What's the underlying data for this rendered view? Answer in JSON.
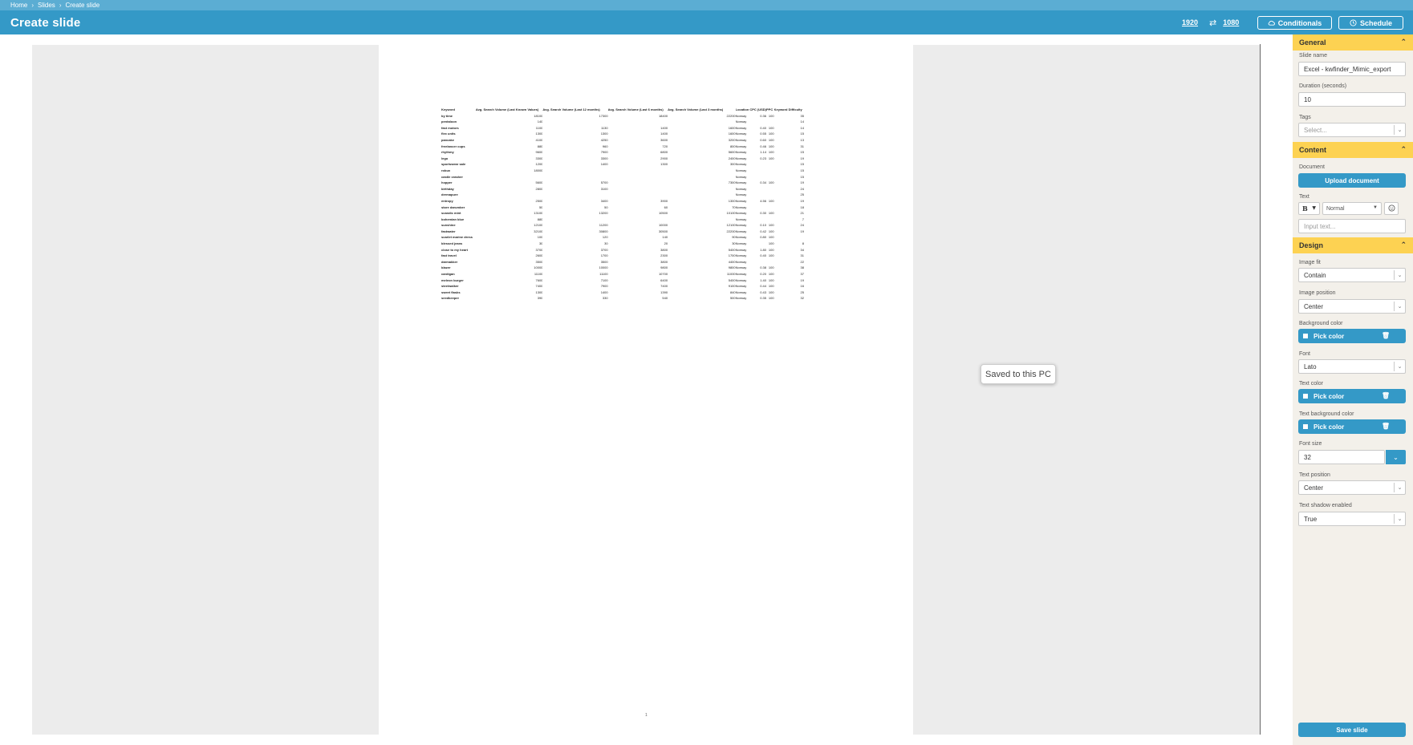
{
  "breadcrumb": [
    "Home",
    "Slides",
    "Create slide"
  ],
  "header": {
    "title": "Create slide",
    "width": "1920",
    "height": "1080",
    "conditionals_label": "Conditionals",
    "schedule_label": "Schedule"
  },
  "preview": {
    "page_number": "1",
    "toast": "Saved to this PC"
  },
  "table": {
    "headers": [
      "Keyword",
      "Avg. Search Volume (Last Known Values)",
      "Avg. Search Volume (Last 12 months)",
      "Avg. Search Volume (Last 6 months)",
      "Avg. Search Volume (Last 3 months)",
      "Location",
      "CPC (USD)",
      "PPC",
      "Keyword Difficulty"
    ],
    "rows": [
      [
        "by time",
        "18100",
        "17300",
        "18400",
        "22200",
        "Norway",
        "0.36",
        "100",
        "35"
      ],
      [
        "pentaloon",
        "140",
        "",
        "",
        "",
        "Norway",
        "",
        "",
        "14"
      ],
      [
        "fast motors",
        "1100",
        "1130",
        "1400",
        "1600",
        "Norway",
        "0.40",
        "100",
        "14"
      ],
      [
        "flex units",
        "1300",
        "1300",
        "1400",
        "1600",
        "Norway",
        "0.55",
        "100",
        "15"
      ],
      [
        "pancake",
        "4100",
        "4250",
        "3600",
        "3200",
        "Norway",
        "0.60",
        "100",
        "13"
      ],
      [
        "freelancer cups",
        "880",
        "960",
        "720",
        "800",
        "Norway",
        "0.46",
        "100",
        "31"
      ],
      [
        "rhythmy",
        "9600",
        "7900",
        "6800",
        "5600",
        "Norway",
        "1.14",
        "100",
        "15"
      ],
      [
        "lego",
        "3300",
        "3300",
        "2900",
        "2400",
        "Norway",
        "0.23",
        "100",
        "19"
      ],
      [
        "sportswear sale",
        "1200",
        "1400",
        "1300",
        "300",
        "Norway",
        "",
        "",
        "15"
      ],
      [
        "robux",
        "18000",
        "",
        "",
        "",
        "Norway",
        "",
        "",
        "15"
      ],
      [
        "castle crasher",
        "",
        "",
        "",
        "",
        "Norway",
        "",
        "",
        "15"
      ],
      [
        "hopper",
        "5600",
        "5700",
        "",
        "7300",
        "Norway",
        "0.34",
        "100",
        "19"
      ],
      [
        "birthday",
        "2800",
        "3100",
        "",
        "",
        "Norway",
        "",
        "",
        "24"
      ],
      [
        "dermapure",
        "",
        "",
        "",
        "",
        "Norway",
        "",
        "",
        "25"
      ],
      [
        "entropy",
        "2500",
        "3400",
        "3900",
        "1300",
        "Norway",
        "4.56",
        "100",
        "19"
      ],
      [
        "store darumber",
        "50",
        "50",
        "60",
        "70",
        "Norway",
        "",
        "",
        "18"
      ],
      [
        "scandic mint",
        "13100",
        "13200",
        "10500",
        "10100",
        "Norway",
        "0.30",
        "100",
        "21"
      ],
      [
        "bohemian blue",
        "880",
        "",
        "",
        "",
        "Norway",
        "",
        "",
        "7"
      ],
      [
        "sunshine",
        "12100",
        "11200",
        "10000",
        "12100",
        "Norway",
        "0.10",
        "100",
        "24"
      ],
      [
        "fastwater",
        "32100",
        "30800",
        "30500",
        "22200",
        "Norway",
        "0.42",
        "100",
        "19"
      ],
      [
        "scarlet marine dress",
        "100",
        "120",
        "140",
        "90",
        "Norway",
        "0.80",
        "100",
        ""
      ],
      [
        "blessed jeans",
        "30",
        "30",
        "20",
        "30",
        "Norway",
        "",
        "100",
        "8"
      ],
      [
        "close to my heart",
        "3700",
        "3700",
        "3800",
        "5400",
        "Norway",
        "1.80",
        "100",
        "34"
      ],
      [
        "fast travel",
        "2600",
        "1700",
        "2300",
        "1700",
        "Norway",
        "0.40",
        "100",
        "31"
      ],
      [
        "darmakker",
        "3500",
        "3500",
        "3800",
        "4400",
        "Norway",
        "",
        "",
        "22"
      ],
      [
        "blazer",
        "10000",
        "10000",
        "9800",
        "9800",
        "Norway",
        "0.38",
        "100",
        "38"
      ],
      [
        "cardigan",
        "11100",
        "11100",
        "10700",
        "11000",
        "Norway",
        "0.20",
        "100",
        "37"
      ],
      [
        "meleon burger",
        "7600",
        "7100",
        "6400",
        "5400",
        "Norway",
        "1.40",
        "100",
        "19"
      ],
      [
        "steelwalker",
        "7400",
        "7900",
        "7400",
        "9100",
        "Norway",
        "0.44",
        "100",
        "16"
      ],
      [
        "sweet flasks",
        "1300",
        "1400",
        "1390",
        "840",
        "Norway",
        "0.43",
        "100",
        "25"
      ],
      [
        "seedkeeper",
        "390",
        "330",
        "540",
        "500",
        "Norway",
        "0.35",
        "100",
        "32"
      ]
    ]
  },
  "sidebar": {
    "general": {
      "title": "General",
      "slide_name_label": "Slide name",
      "slide_name_value": "Excel - kwfinder_Mimic_export",
      "duration_label": "Duration (seconds)",
      "duration_value": "10",
      "tags_label": "Tags",
      "tags_placeholder": "Select..."
    },
    "content": {
      "title": "Content",
      "document_label": "Document",
      "upload_label": "Upload document",
      "text_label": "Text",
      "bold_label": "B",
      "style_value": "Normal",
      "text_placeholder": "Input text..."
    },
    "design": {
      "title": "Design",
      "image_fit_label": "Image fit",
      "image_fit_value": "Contain",
      "image_position_label": "Image position",
      "image_position_value": "Center",
      "background_color_label": "Background color",
      "font_label": "Font",
      "font_value": "Lato",
      "text_color_label": "Text color",
      "text_bg_color_label": "Text background color",
      "pick_color_label": "Pick color",
      "font_size_label": "Font size",
      "font_size_value": "32",
      "text_position_label": "Text position",
      "text_position_value": "Center",
      "text_shadow_label": "Text shadow enabled",
      "text_shadow_value": "True"
    },
    "save_label": "Save slide"
  },
  "colors": {
    "header_blue": "#3499c7",
    "breadcrumb_blue": "#5badd3",
    "section_yellow": "#fdd252",
    "sidebar_bg": "#f3f0ea"
  }
}
